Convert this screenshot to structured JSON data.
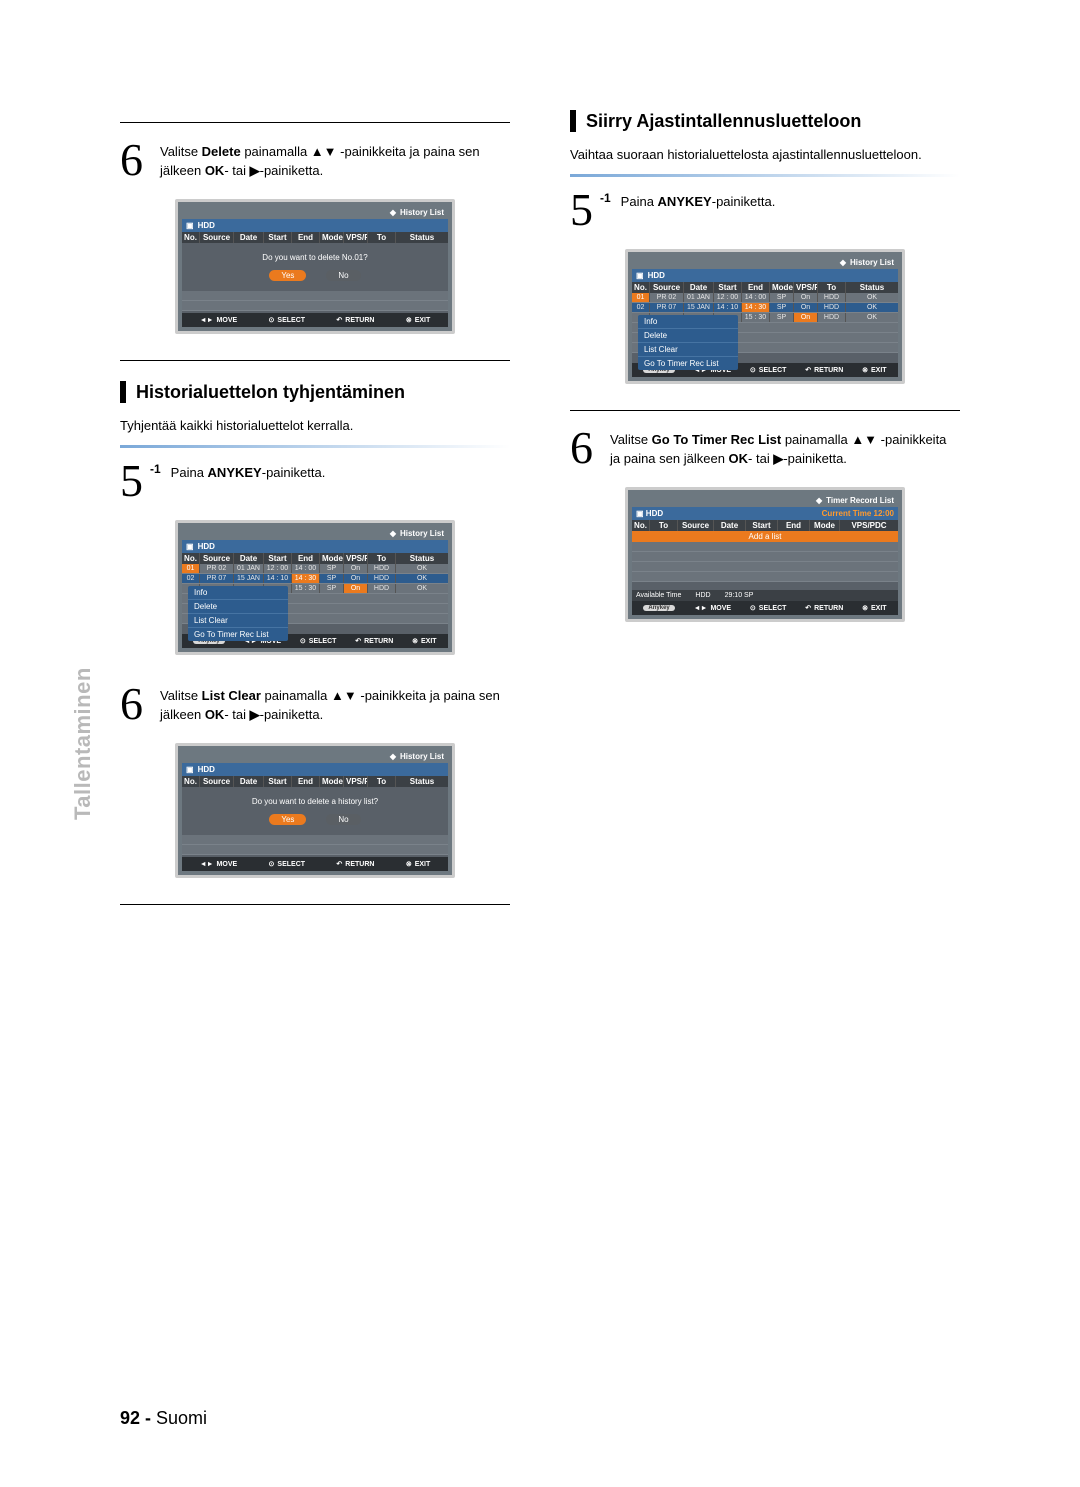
{
  "side_label": "Tallentaminen",
  "page_number_prefix": "92 - ",
  "page_number_suffix": "Suomi",
  "left": {
    "step6a_before": "Valitse ",
    "step6a_bold1": "Delete",
    "step6a_mid": " painamalla ▲▼ -painikkeita ja paina sen jälkeen ",
    "step6a_bold2": "OK",
    "step6a_mid2": "- tai ",
    "step6a_bold3": "▶",
    "step6a_after": "-painiketta.",
    "section1_title": "Historialuettelon tyhjentäminen",
    "section1_intro": "Tyhjentää kaikki historialuettelot kerralla.",
    "step5_sub": "-1",
    "step5_before": "Paina ",
    "step5_bold": "ANYKEY",
    "step5_after": "-painiketta.",
    "step6b_before": "Valitse ",
    "step6b_bold1": "List Clear",
    "step6b_mid": " painamalla ▲▼ -painikkeita ja paina sen jälkeen ",
    "step6b_bold2": "OK",
    "step6b_mid2": "- tai ",
    "step6b_bold3": "▶",
    "step6b_after": "-painiketta."
  },
  "right": {
    "section_title": "Siirry Ajastintallennusluetteloon",
    "section_intro": "Vaihtaa suoraan historialuettelosta ajastintallennusluetteloon.",
    "step5_sub": "-1",
    "step5_before": "Paina ",
    "step5_bold": "ANYKEY",
    "step5_after": "-painiketta.",
    "step6_before": "Valitse ",
    "step6_bold1": "Go To Timer Rec List",
    "step6_mid": " painamalla ▲▼ -painikkeita ja paina sen jälkeen ",
    "step6_bold2": "OK",
    "step6_mid2": "- tai ",
    "step6_bold3": "▶",
    "step6_after": "-painiketta."
  },
  "dvr_common": {
    "hdd": "HDD",
    "history_title": "History List",
    "footer_move": "MOVE",
    "footer_select": "SELECT",
    "footer_return": "RETURN",
    "footer_exit": "EXIT",
    "anykey": "Anykey",
    "hdr": {
      "no": "No.",
      "src": "Source",
      "date": "Date",
      "start": "Start",
      "end": "End",
      "mode": "Mode",
      "vps": "VPS/PDC",
      "to": "To",
      "status": "Status"
    }
  },
  "dvr_delete": {
    "prompt": "Do you want to delete No.01?",
    "yes": "Yes",
    "no": "No"
  },
  "dvr_menu": {
    "rows": [
      {
        "no": "01",
        "src": "PR 02",
        "date": "01 JAN",
        "start": "12 : 00",
        "end": "14 : 00",
        "mode": "SP",
        "vps": "On",
        "to": "HDD",
        "status": "OK"
      },
      {
        "no": "02",
        "src": "PR 07",
        "date": "15 JAN",
        "start": "14 : 10",
        "end": "14 : 30",
        "mode": "SP",
        "vps": "On",
        "to": "HDD",
        "status": "OK"
      },
      {
        "no": "",
        "src": "",
        "date": "",
        "start": "",
        "end": "15 : 30",
        "mode": "SP",
        "vps": "On",
        "to": "HDD",
        "status": "OK"
      }
    ],
    "menu": [
      "Info",
      "Delete",
      "List Clear",
      "Go To Timer Rec List"
    ]
  },
  "dvr_clear": {
    "prompt": "Do you want to delete a history list?",
    "yes": "Yes",
    "no": "No"
  },
  "dvr_timer": {
    "title": "Timer Record List",
    "current_time_label": "Current Time",
    "current_time": "12:00",
    "hdr": {
      "no": "No.",
      "to": "To",
      "src": "Source",
      "date": "Date",
      "start": "Start",
      "end": "End",
      "mode": "Mode",
      "vps": "VPS/PDC"
    },
    "add": "Add a list",
    "avail_label": "Available Time",
    "avail_hdd": "HDD",
    "avail_time": "29:10 SP"
  }
}
